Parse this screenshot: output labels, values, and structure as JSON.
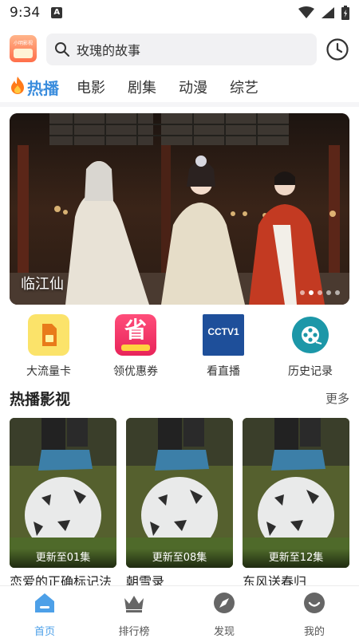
{
  "status_bar": {
    "time": "9:34",
    "notification_glyph": "A"
  },
  "top": {
    "logo_text": "小明影视",
    "search_placeholder": "玫瑰的故事"
  },
  "tabs": [
    {
      "label": "热播",
      "active": true
    },
    {
      "label": "电影"
    },
    {
      "label": "剧集"
    },
    {
      "label": "动漫"
    },
    {
      "label": "综艺"
    }
  ],
  "banner": {
    "title": "临江仙",
    "dot_count": 5,
    "active_dot": 1
  },
  "quick_access": [
    {
      "label": "大流量卡",
      "icon": "sim-card-icon"
    },
    {
      "label": "领优惠券",
      "icon": "coupon-icon",
      "badge": "省"
    },
    {
      "label": "看直播",
      "icon": "tv-live-icon",
      "badge": "CCTV1"
    },
    {
      "label": "历史记录",
      "icon": "film-reel-icon"
    }
  ],
  "hot": {
    "title": "热播影视",
    "more": "更多",
    "cards": [
      {
        "update": "更新至01集",
        "title": "恋爱的正确标记法"
      },
      {
        "update": "更新至08集",
        "title": "朝雪录"
      },
      {
        "update": "更新至12集",
        "title": "东风送春归"
      }
    ]
  },
  "bottom_nav": [
    {
      "label": "首页",
      "icon": "home-icon",
      "active": true
    },
    {
      "label": "排行榜",
      "icon": "crown-icon"
    },
    {
      "label": "发现",
      "icon": "discover-icon"
    },
    {
      "label": "我的",
      "icon": "profile-icon"
    }
  ],
  "colors": {
    "accent": "#3b8ddd",
    "nav_active": "#4da0e8",
    "search_bg": "#f1f1f3"
  }
}
